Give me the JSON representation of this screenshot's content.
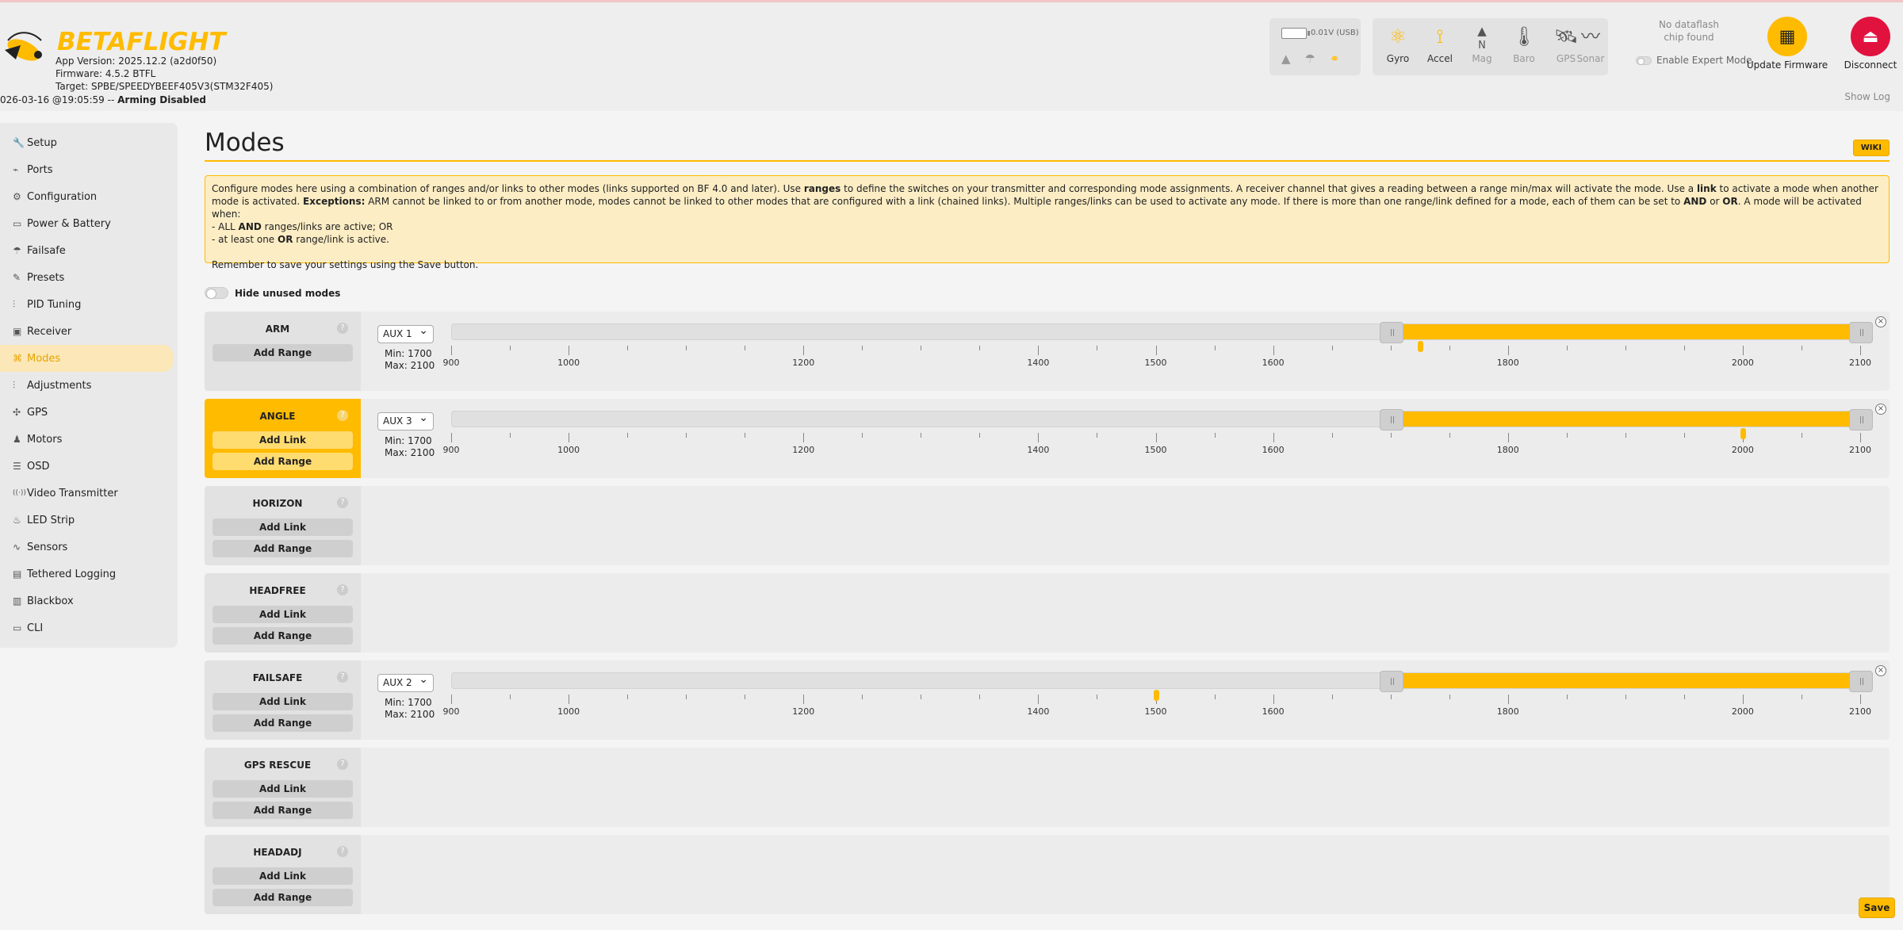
{
  "header": {
    "logo_text_beta": "BETA",
    "logo_text_flight": "FLIGHT",
    "app_version": "App Version: 2025.12.2 (a2d0f50)",
    "firmware": "Firmware: 4.5.2 BTFL",
    "target": "Target: SPBE/SPEEDYBEEF405V3(STM32F405)",
    "status_date": "026-03-16 @19:05:59 -- ",
    "status_arming": "Arming Disabled",
    "battery_voltage": "0.01V (USB)",
    "sensors": [
      {
        "label": "Gyro",
        "icon": "gyro-icon",
        "state": "on"
      },
      {
        "label": "Accel",
        "icon": "accel-icon",
        "state": "on"
      },
      {
        "label": "Mag",
        "icon": "mag-icon",
        "state": "off"
      },
      {
        "label": "Baro",
        "icon": "baro-icon",
        "state": "off"
      },
      {
        "label": "GPS",
        "icon": "gps-icon",
        "state": "off"
      },
      {
        "label": "Sonar",
        "icon": "sonar-icon",
        "state": "off"
      }
    ],
    "mag_letter": "N",
    "dataflash_line1": "No dataflash",
    "dataflash_line2": "chip found",
    "expert_mode_label": "Enable Expert Mode",
    "update_firmware_label": "Update Firmware",
    "disconnect_label": "Disconnect",
    "show_log_label": "Show Log"
  },
  "sidebar": {
    "items": [
      {
        "label": "Setup",
        "icon": "wrench-icon"
      },
      {
        "label": "Ports",
        "icon": "plug-icon"
      },
      {
        "label": "Configuration",
        "icon": "gear-icon"
      },
      {
        "label": "Power & Battery",
        "icon": "battery-icon"
      },
      {
        "label": "Failsafe",
        "icon": "parachute-icon"
      },
      {
        "label": "Presets",
        "icon": "magic-wand-icon"
      },
      {
        "label": "PID Tuning",
        "icon": "sliders-icon"
      },
      {
        "label": "Receiver",
        "icon": "receiver-icon"
      },
      {
        "label": "Modes",
        "icon": "modes-icon",
        "active": true
      },
      {
        "label": "Adjustments",
        "icon": "adjust-icon"
      },
      {
        "label": "GPS",
        "icon": "satellite-icon"
      },
      {
        "label": "Motors",
        "icon": "motor-icon"
      },
      {
        "label": "OSD",
        "icon": "osd-icon"
      },
      {
        "label": "Video Transmitter",
        "icon": "vtx-icon"
      },
      {
        "label": "LED Strip",
        "icon": "led-icon"
      },
      {
        "label": "Sensors",
        "icon": "pulse-icon"
      },
      {
        "label": "Tethered Logging",
        "icon": "log-icon"
      },
      {
        "label": "Blackbox",
        "icon": "blackbox-icon"
      },
      {
        "label": "CLI",
        "icon": "terminal-icon"
      }
    ]
  },
  "main": {
    "title": "Modes",
    "wiki_label": "WIKI",
    "note": {
      "p1_a": "Configure modes here using a combination of ranges and/or links to other modes (links supported on BF 4.0 and later). Use ",
      "p1_b": "ranges",
      "p1_c": " to define the switches on your transmitter and corresponding mode assignments. A receiver channel that gives a reading between a range min/max will activate the mode. Use a ",
      "p1_d": "link",
      "p1_e": " to activate a mode when another mode is activated. ",
      "p1_f": "Exceptions:",
      "p1_g": " ARM cannot be linked to or from another mode, modes cannot be linked to other modes that are configured with a link (chained links). Multiple ranges/links can be used to activate any mode. If there is more than one range/link defined for a mode, each of them can be set to ",
      "p1_h": "AND",
      "p1_i": " or ",
      "p1_j": "OR",
      "p1_k": ". A mode will be activated when:",
      "p2_a": "- ALL ",
      "p2_b": "AND",
      "p2_c": " ranges/links are active; OR",
      "p3_a": "- at least one ",
      "p3_b": "OR",
      "p3_c": " range/link is active.",
      "p4": "Remember to save your settings using the Save button."
    },
    "hide_unused_label": "Hide unused modes",
    "add_link_label": "Add Link",
    "add_range_label": "Add Range",
    "help_glyph": "?",
    "remove_glyph": "×",
    "tick_labels": [
      "900",
      "1000",
      "1200",
      "1400",
      "1500",
      "1600",
      "1800",
      "2000",
      "2100"
    ],
    "modes": [
      {
        "name": "ARM",
        "active": false,
        "has_link": false,
        "range": {
          "channel": "AUX 1",
          "min_label": "Min: 1700",
          "max_label": "Max: 2100",
          "min": 1700,
          "max": 2100,
          "current": 1725
        }
      },
      {
        "name": "ANGLE",
        "active": true,
        "has_link": true,
        "range": {
          "channel": "AUX 3",
          "min_label": "Min: 1700",
          "max_label": "Max: 2100",
          "min": 1700,
          "max": 2100,
          "current": 2000
        }
      },
      {
        "name": "HORIZON",
        "active": false,
        "has_link": true,
        "range": null
      },
      {
        "name": "HEADFREE",
        "active": false,
        "has_link": true,
        "range": null
      },
      {
        "name": "FAILSAFE",
        "active": false,
        "has_link": true,
        "range": {
          "channel": "AUX 2",
          "min_label": "Min: 1700",
          "max_label": "Max: 2100",
          "min": 1700,
          "max": 2100,
          "current": 1500
        }
      },
      {
        "name": "GPS RESCUE",
        "active": false,
        "has_link": true,
        "range": null
      },
      {
        "name": "HEADADJ",
        "active": false,
        "has_link": true,
        "range": null
      }
    ],
    "save_label": "Save"
  },
  "colors": {
    "accent": "#ffbb00",
    "disconnect": "#e2123f",
    "note_bg": "#fcedc4"
  }
}
